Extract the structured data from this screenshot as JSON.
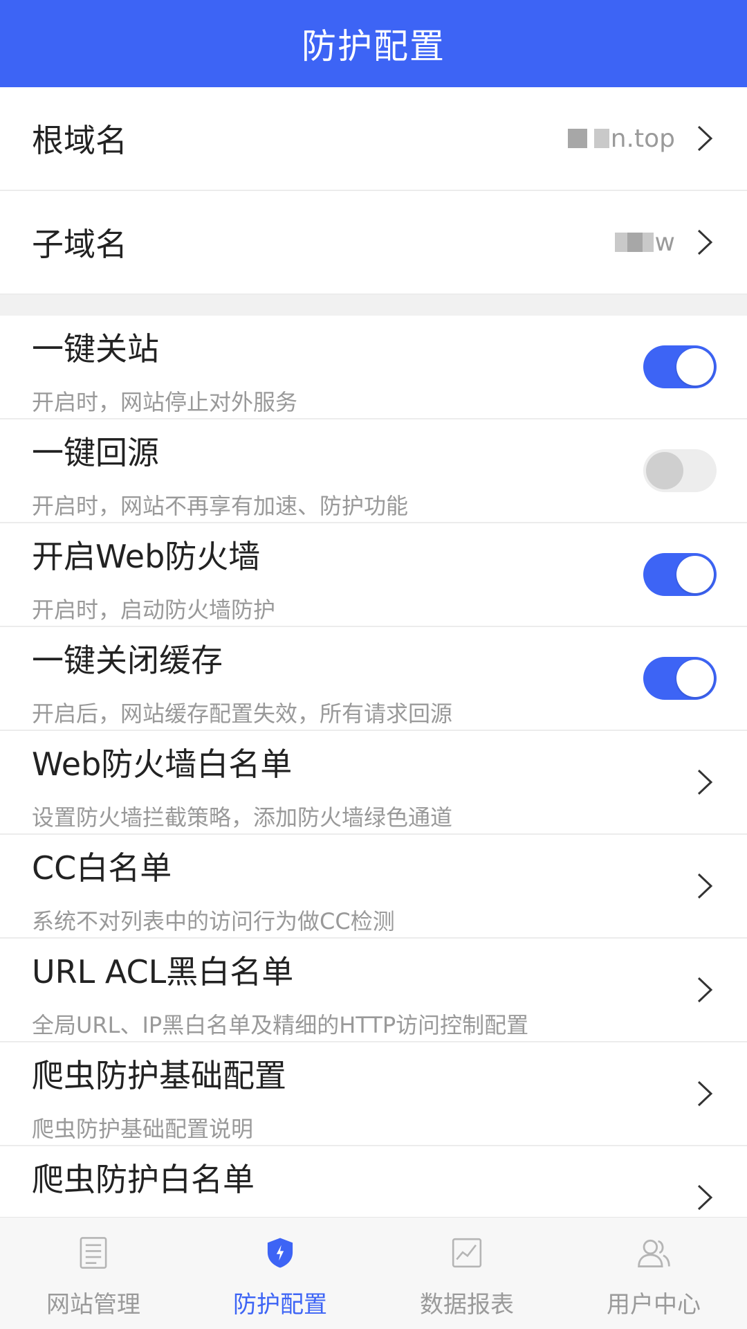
{
  "header": {
    "title": "防护配置"
  },
  "domains": [
    {
      "label": "根域名",
      "value": "n.top"
    },
    {
      "label": "子域名",
      "value": "w"
    }
  ],
  "settings": [
    {
      "title": "一键关站",
      "desc": "开启时，网站停止对外服务",
      "control": "toggle",
      "state": "on"
    },
    {
      "title": "一键回源",
      "desc": "开启时，网站不再享有加速、防护功能",
      "control": "toggle",
      "state": "off"
    },
    {
      "title": "开启Web防火墙",
      "desc": "开启时，启动防火墙防护",
      "control": "toggle",
      "state": "on"
    },
    {
      "title": "一键关闭缓存",
      "desc": "开启后，网站缓存配置失效，所有请求回源",
      "control": "toggle",
      "state": "on"
    },
    {
      "title": "Web防火墙白名单",
      "desc": "设置防火墙拦截策略，添加防火墙绿色通道",
      "control": "chevron"
    },
    {
      "title": "CC白名单",
      "desc": "系统不对列表中的访问行为做CC检测",
      "control": "chevron"
    },
    {
      "title": "URL ACL黑白名单",
      "desc": "全局URL、IP黑白名单及精细的HTTP访问控制配置",
      "control": "chevron"
    },
    {
      "title": "爬虫防护基础配置",
      "desc": "爬虫防护基础配置说明",
      "control": "chevron"
    },
    {
      "title": "爬虫防护白名单",
      "desc": "",
      "control": "chevron"
    }
  ],
  "tabbar": {
    "items": [
      {
        "label": "网站管理",
        "icon": "document-icon",
        "active": false
      },
      {
        "label": "防护配置",
        "icon": "shield-icon",
        "active": true
      },
      {
        "label": "数据报表",
        "icon": "chart-icon",
        "active": false
      },
      {
        "label": "用户中心",
        "icon": "users-icon",
        "active": false
      }
    ]
  },
  "colors": {
    "accent": "#3d64f5",
    "header_bg": "#3d64f5",
    "muted": "#999999",
    "toggle_off": "#ededed"
  }
}
